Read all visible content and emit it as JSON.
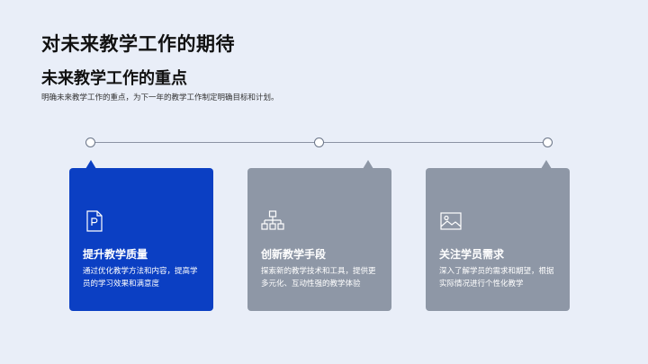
{
  "page": {
    "title": "对未来教学工作的期待"
  },
  "section": {
    "title": "未来教学工作的重点",
    "description": "明确未来教学工作的重点，为下一年的教学工作制定明确目标和计划。"
  },
  "cards": [
    {
      "icon": "document-p-icon",
      "title": "提升教学质量",
      "description": "通过优化教学方法和内容，提高学员的学习效果和满意度",
      "color": "#0b3fc3"
    },
    {
      "icon": "hierarchy-icon",
      "title": "创新教学手段",
      "description": "探索新的教学技术和工具，提供更多元化、互动性强的教学体验",
      "color": "#8e97a6"
    },
    {
      "icon": "image-icon",
      "title": "关注学员需求",
      "description": "深入了解学员的需求和期望，根据实际情况进行个性化教学",
      "color": "#8e97a6"
    }
  ],
  "colors": {
    "background": "#e9eef8",
    "accent": "#0b3fc3",
    "muted": "#8e97a6"
  }
}
